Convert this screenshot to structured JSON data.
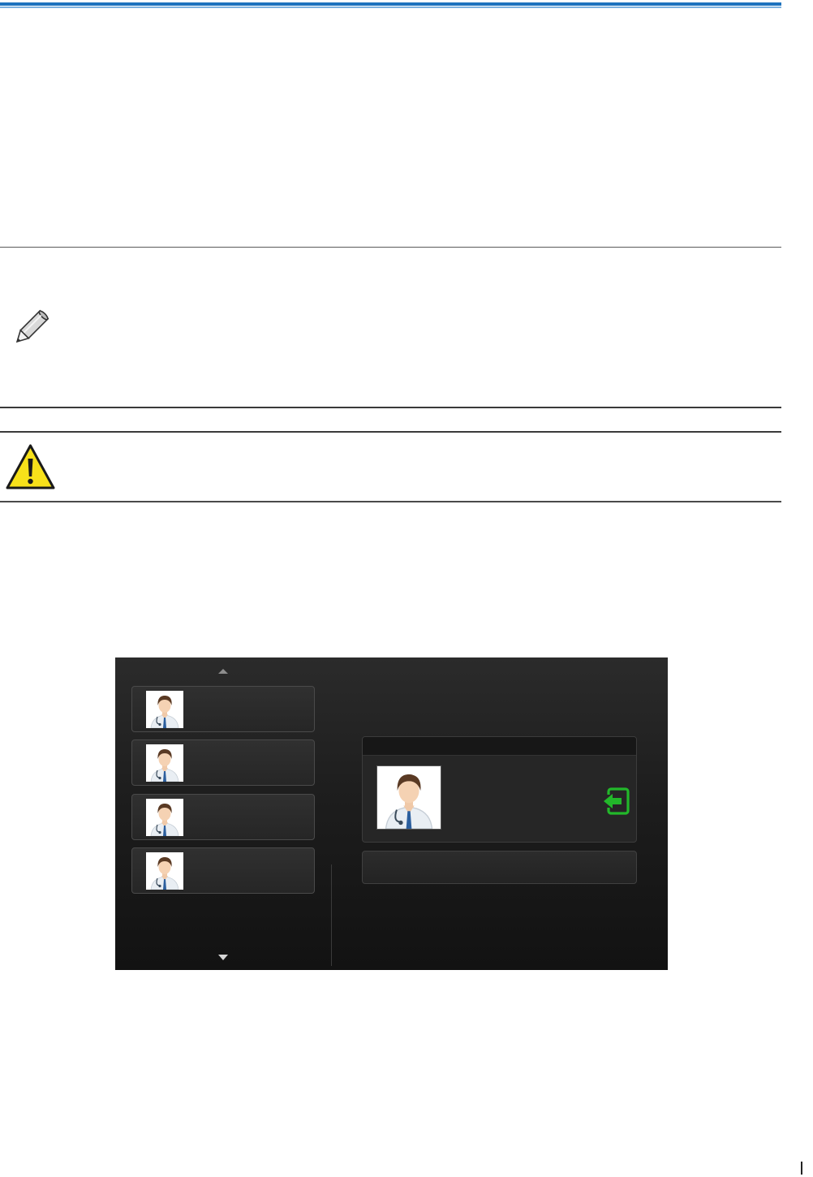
{
  "page": {
    "accent_color": "#1e73be",
    "icons": {
      "note": "pencil-icon",
      "caution": "warning-triangle-icon",
      "scroll_up": "chevron-up-icon",
      "scroll_down": "chevron-down-icon",
      "login": "login-arrow-icon"
    }
  },
  "device_screen": {
    "user_list": [
      {
        "avatar": "doctor-avatar"
      },
      {
        "avatar": "doctor-avatar"
      },
      {
        "avatar": "doctor-avatar"
      },
      {
        "avatar": "doctor-avatar"
      }
    ],
    "selected_user": {
      "avatar": "doctor-avatar"
    },
    "login_icon_color": "#22b82a"
  }
}
